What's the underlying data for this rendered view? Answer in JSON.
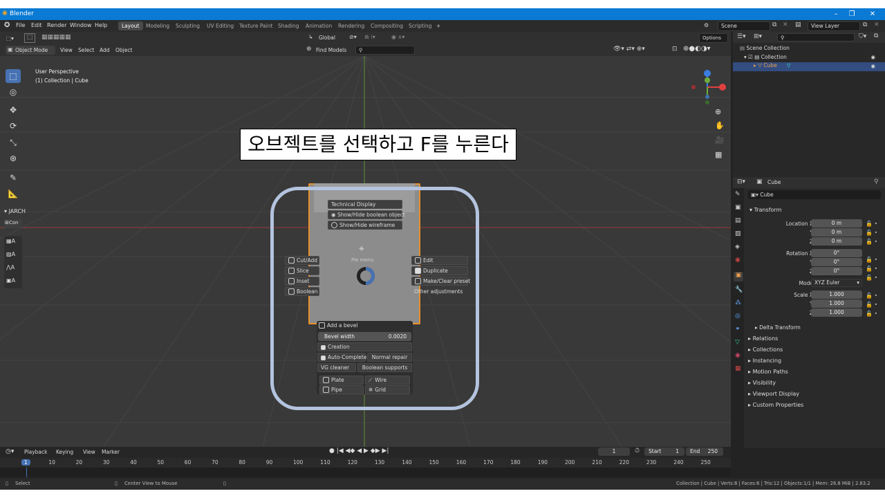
{
  "window": {
    "title": "Blender",
    "minimize": "–",
    "maximize": "❐",
    "close": "✕"
  },
  "menus": [
    "File",
    "Edit",
    "Render",
    "Window",
    "Help"
  ],
  "workspaces": [
    "Layout",
    "Modeling",
    "Sculpting",
    "UV Editing",
    "Texture Paint",
    "Shading",
    "Animation",
    "Rendering",
    "Compositing",
    "Scripting"
  ],
  "workspace_add": "+",
  "scene": {
    "name": "Scene",
    "view_layer": "View Layer"
  },
  "viewport": {
    "mode": "Object Mode",
    "menus": [
      "View",
      "Select",
      "Add",
      "Object"
    ],
    "transform_orientation": "Global",
    "find_models": "Find Models",
    "options": "Options",
    "perspective": "User Perspective",
    "collection_info": "(1) Collection | Cube",
    "jarch_panel": "JARCH",
    "con_label": "Con",
    "jarch_tools": [
      "A",
      "A",
      "A",
      "A"
    ],
    "tooltip_name": "Pie menu"
  },
  "caption": "오브젝트를 선택하고 F를 누른다",
  "pie_menu": {
    "top": [
      "Technical Display",
      "Show/Hide boolean object",
      "Show/Hide wireframe"
    ],
    "left": [
      "Cut/Add",
      "Slice",
      "Inset",
      "Boolean"
    ],
    "right": [
      "Edit",
      "Duplicate",
      "Make/Clear preset"
    ],
    "right_note": "Other adjustments",
    "bottom": {
      "add_bevel": "Add a bevel",
      "bevel_width_label": "Bevel width",
      "bevel_width_value": "0.0020",
      "creation": "Creation",
      "auto_complete": "Auto-Complete",
      "normal_repair": "Normal repair",
      "vg_cleaner": "VG cleaner",
      "boolean_supports": "Boolean supports",
      "shapes": [
        "Plate",
        "Wire",
        "Pipe",
        "Grid"
      ]
    }
  },
  "outliner": {
    "scene_collection": "Scene Collection",
    "collection": "Collection",
    "object": "Cube"
  },
  "properties": {
    "object_path": "Cube",
    "object_name": "Cube",
    "transform_header": "Transform",
    "location": [
      {
        "label": "Location X",
        "value": "0 m"
      },
      {
        "label": "Y",
        "value": "0 m"
      },
      {
        "label": "Z",
        "value": "0 m"
      }
    ],
    "rotation": [
      {
        "label": "Rotation X",
        "value": "0°"
      },
      {
        "label": "Y",
        "value": "0°"
      },
      {
        "label": "Z",
        "value": "0°"
      }
    ],
    "mode_label": "Mode",
    "mode_value": "XYZ Euler",
    "scale": [
      {
        "label": "Scale X",
        "value": "1.000"
      },
      {
        "label": "Y",
        "value": "1.000"
      },
      {
        "label": "Z",
        "value": "1.000"
      }
    ],
    "delta_transform": "Delta Transform",
    "sections": [
      "Relations",
      "Collections",
      "Instancing",
      "Motion Paths",
      "Visibility",
      "Viewport Display",
      "Custom Properties"
    ]
  },
  "timeline": {
    "menus": [
      "Playback",
      "Keying",
      "View",
      "Marker"
    ],
    "current_frame": "1",
    "start_label": "Start",
    "start": "1",
    "end_label": "End",
    "end": "250",
    "ticks": [
      "1",
      "10",
      "20",
      "30",
      "40",
      "50",
      "60",
      "70",
      "80",
      "90",
      "100",
      "110",
      "120",
      "130",
      "140",
      "150",
      "160",
      "170",
      "180",
      "190",
      "200",
      "210",
      "220",
      "230",
      "240",
      "250"
    ]
  },
  "status": {
    "select": "Select",
    "center_view": "Center View to Mouse",
    "stats": "Collection | Cube | Verts:8 | Faces:6 | Tris:12 | Objects:1/1 | Mem: 26.8 MiB | 2.83.2"
  },
  "colors": {
    "accent": "#4772b3",
    "title_bar": "#0a7ad4",
    "selection_outline": "#e8902a",
    "highlight_ring": "#b4c3de"
  }
}
